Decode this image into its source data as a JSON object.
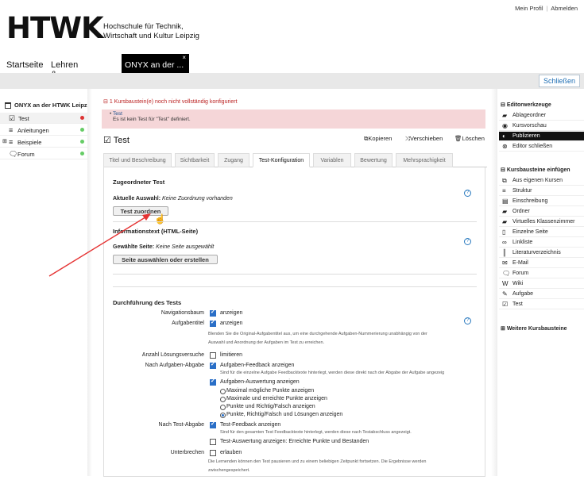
{
  "header": {
    "logo_text": "HTWK",
    "logo_subtitle_1": "Hochschule für Technik,",
    "logo_subtitle_2": "Wirtschaft und Kultur Leipzig",
    "profile_link": "Mein Profil",
    "separator": "|",
    "logout_link": "Abmelden"
  },
  "nav": {
    "home": "Startseite",
    "learning": "Lehren & Lernen",
    "active_tab": "ONYX an der ...",
    "active_close": "×"
  },
  "close_button": "Schließen",
  "course_tree": {
    "title": "ONYX an der HTWK Leipzig",
    "items": [
      {
        "label": "Test",
        "icon": "test-icon",
        "status_color": "#d33"
      },
      {
        "label": "Anleitungen",
        "icon": "structure-icon",
        "status_color": "#6c6"
      },
      {
        "label": "Beispiele",
        "icon": "structure-icon",
        "status_color": "#6c6"
      },
      {
        "label": "Forum",
        "icon": "forum-icon",
        "status_color": "#6c6"
      }
    ]
  },
  "main": {
    "warning": "1 Kursbaustein(e) noch nicht vollständig konfiguriert",
    "error_title": "Test",
    "error_text": "Es ist kein Test für \"Test\" definiert.",
    "node_title": "Test",
    "toolbar": {
      "copy": "Kopieren",
      "move": "Verschieben",
      "delete": "Löschen"
    },
    "tabs": [
      "Titel und Beschreibung",
      "Sichtbarkeit",
      "Zugang",
      "Test-Konfiguration",
      "Variablen",
      "Bewertung",
      "Mehrsprachigkeit"
    ],
    "assigned_test": {
      "title": "Zugeordneter Test",
      "current_label": "Aktuelle Auswahl:",
      "current_value": "Keine Zuordnung vorhanden",
      "button": "Test zuordnen"
    },
    "info_text": {
      "title": "Informationstext (HTML-Seite)",
      "selected_label": "Gewählte Seite:",
      "selected_value": "Keine Seite ausgewählt",
      "button": "Seite auswählen oder erstellen"
    },
    "execution": {
      "title": "Durchführung des Tests",
      "nav_tree_label": "Navigationsbaum",
      "nav_tree_value": "anzeigen",
      "task_title_label": "Aufgabentitel",
      "task_title_value": "anzeigen",
      "task_title_help": "Blenden Sie die Original-Aufgabentitel aus, um eine durchgehende Aufgaben-Nummerierung unabhängig von der",
      "task_title_help2": "Auswahl und Anordnung der Aufgaben im Test zu erreichen.",
      "attempts_label": "Anzahl Lösungsversuche",
      "attempts_value": "limitieren",
      "after_task_label": "Nach Aufgaben-Abgabe",
      "feedback_value": "Aufgaben-Feedback anzeigen",
      "feedback_help": "Sind für die einzelne Aufgabe Feedbacktexte hinterlegt, werden diese direkt nach der Abgabe der Aufgabe angezeig",
      "evaluation_value": "Aufgaben-Auswertung anzeigen",
      "radios": [
        "Maximal mögliche Punkte anzeigen",
        "Maximale und erreichte Punkte anzeigen",
        "Punkte und Richtig/Falsch anzeigen",
        "Punkte, Richtig/Falsch und Lösungen anzeigen"
      ],
      "after_test_label": "Nach Test-Abgabe",
      "test_feedback_value": "Test-Feedback anzeigen",
      "test_feedback_help": "Sind für den gesamten Test Feedbacktexte hinterlegt, werden diese nach Testabschluss angezeigt.",
      "test_eval_value": "Test-Auswertung anzeigen: Erreichte Punkte und Bestanden",
      "interrupt_label": "Unterbrechen",
      "interrupt_value": "erlauben",
      "interrupt_help": "Die Lernenden können den Test pausieren und zu einem beliebigen Zeitpunkt fortsetzen. Die Ergebnisse werden",
      "interrupt_help2": "zwischengespeichert."
    }
  },
  "editor_tools": {
    "title": "Editorwerkzeuge",
    "items": [
      {
        "label": "Ablageordner",
        "icon": "folder-icon"
      },
      {
        "label": "Kursvorschau",
        "icon": "eye-icon"
      },
      {
        "label": "Publizieren",
        "icon": "publish-icon"
      },
      {
        "label": "Editor schließen",
        "icon": "close-circle-icon"
      }
    ]
  },
  "course_elements": {
    "title": "Kursbausteine einfügen",
    "items": [
      {
        "label": "Aus eigenen Kursen",
        "icon": "copy-icon"
      },
      {
        "label": "Struktur",
        "icon": "structure-icon"
      },
      {
        "label": "Einschreibung",
        "icon": "enrollment-icon"
      },
      {
        "label": "Ordner",
        "icon": "folder-icon"
      },
      {
        "label": "Virtuelles Klassenzimmer",
        "icon": "folder-icon"
      },
      {
        "label": "Einzelne Seite",
        "icon": "page-icon"
      },
      {
        "label": "Linkliste",
        "icon": "link-icon"
      },
      {
        "label": "Literaturverzeichnis",
        "icon": "library-icon"
      },
      {
        "label": "E-Mail",
        "icon": "email-icon"
      },
      {
        "label": "Forum",
        "icon": "forum-icon"
      },
      {
        "label": "Wiki",
        "icon": "wiki-icon"
      },
      {
        "label": "Aufgabe",
        "icon": "task-icon"
      },
      {
        "label": "Test",
        "icon": "test-icon"
      }
    ]
  },
  "more_elements": "Weitere Kursbausteine"
}
